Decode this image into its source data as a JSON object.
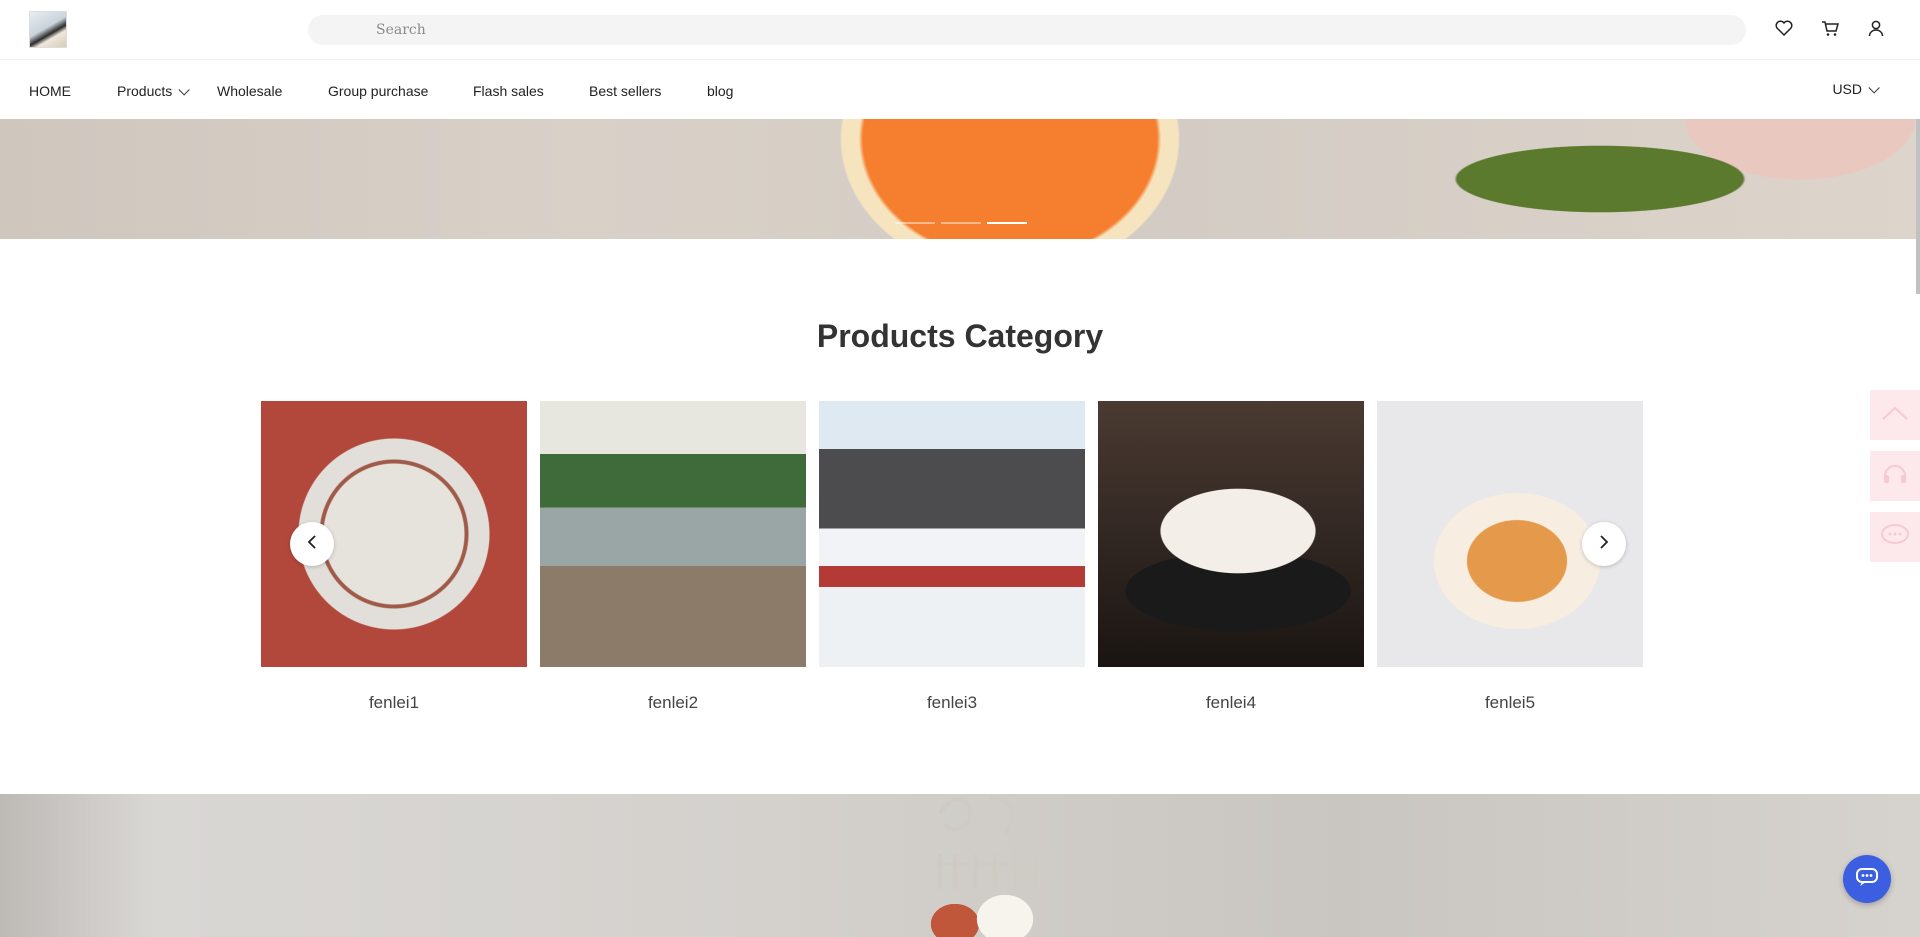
{
  "header": {
    "search_placeholder": "Search",
    "icons": [
      "heart-icon",
      "cart-icon",
      "user-icon"
    ]
  },
  "nav": {
    "items": [
      {
        "label": "HOME"
      },
      {
        "label": "Products",
        "has_dropdown": true
      },
      {
        "label": "Wholesale"
      },
      {
        "label": "Group purchase"
      },
      {
        "label": "Flash sales"
      },
      {
        "label": "Best sellers"
      },
      {
        "label": "blog"
      }
    ],
    "currency": "USD"
  },
  "banner": {
    "slides": 3,
    "active_slide": 3
  },
  "category": {
    "title": "Products Category",
    "items": [
      {
        "label": "fenlei1"
      },
      {
        "label": "fenlei2"
      },
      {
        "label": "fenlei3"
      },
      {
        "label": "fenlei4"
      },
      {
        "label": "fenlei5"
      }
    ],
    "prev_icon": "chevron-left-icon",
    "next_icon": "chevron-right-icon"
  },
  "side_tools": [
    "arrow-up-icon",
    "headset-icon",
    "message-icon"
  ],
  "chat": {
    "icon": "chat-bubble-icon",
    "color": "#3b5fe0"
  }
}
